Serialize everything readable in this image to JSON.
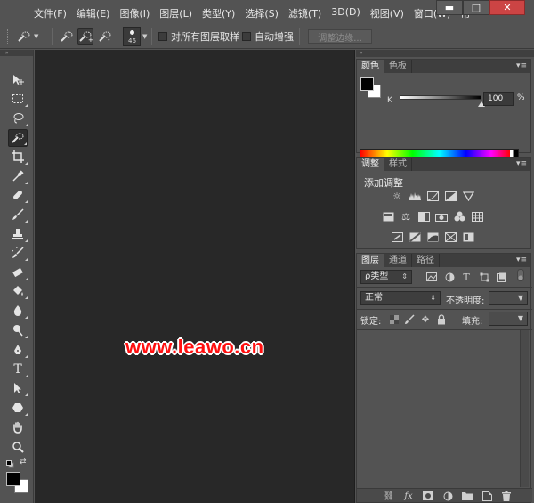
{
  "menubar": {
    "items": [
      "文件(F)",
      "编辑(E)",
      "图像(I)",
      "图层(L)",
      "类型(Y)",
      "选择(S)",
      "滤镜(T)",
      "3D(D)",
      "视图(V)",
      "窗口(W)",
      "帮"
    ],
    "min": "▬",
    "max": "□",
    "close": "✕"
  },
  "options": {
    "brush_size": "46",
    "sample_all_layers": "对所有图层取样",
    "auto_enhance": "自动增强",
    "refine_edge": "调整边缘..."
  },
  "canvas": {
    "watermark": "www.leawo.cn"
  },
  "color_panel": {
    "tabs": [
      "颜色",
      "色板"
    ],
    "k_label": "K",
    "k_value": "100",
    "k_pct": "%"
  },
  "adjust_panel": {
    "tabs": [
      "调整",
      "样式"
    ],
    "title": "添加调整"
  },
  "layers_panel": {
    "tabs": [
      "图层",
      "通道",
      "路径"
    ],
    "filter_type": "ρ类型",
    "blend_mode": "正常",
    "opacity_label": "不透明度:",
    "lock_label": "锁定:",
    "fill_label": "填充:"
  },
  "colors": {
    "accent_watermark": "#ff1010",
    "panel_bg": "#535353",
    "canvas_bg": "#282828"
  }
}
